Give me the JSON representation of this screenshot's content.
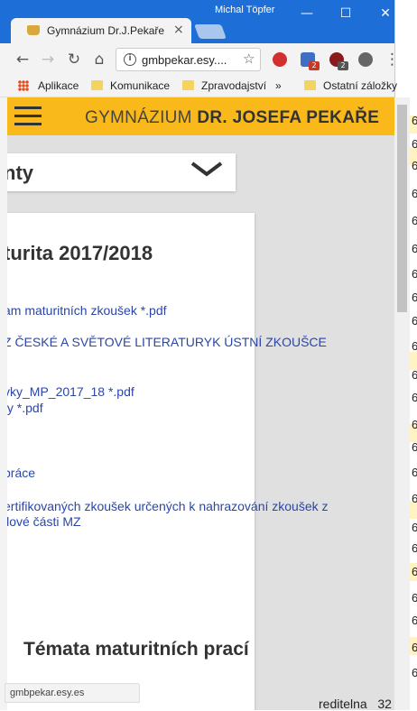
{
  "window": {
    "user": "Michal Töpfer"
  },
  "tab": {
    "title": "Gymnázium Dr.J.Pekaře",
    "close": "×"
  },
  "toolbar": {
    "url": "gmbpekar.esy....",
    "info": "i",
    "star": "☆",
    "menu": "⋮"
  },
  "extensions": {
    "badge1": "2",
    "badge2": "2"
  },
  "bookmarks": [
    {
      "label": "Aplikace"
    },
    {
      "label": "Komunikace"
    },
    {
      "label": "Zpravodajství"
    },
    {
      "label": "»"
    },
    {
      "label": "Ostatní záložky"
    }
  ],
  "site": {
    "brand_light": "GYMNÁZIUM ",
    "brand_bold": "DR. JOSEFA PEKAŘE",
    "select_label": "nty",
    "heading": "turita 2017/2018",
    "links": [
      "am maturitních zkoušek *.pdf",
      "Z ČESKÉ A SVĚTOVÉ LITERATURYK ÚSTNÍ ZKOUŠCE",
      "vky_MP_2017_18 *.pdf",
      "ty *.pdf",
      "práce",
      "ertifikovaných zkoušek určených k nahrazování zkoušek z",
      "ilové části MZ"
    ],
    "section_heading": "Témata maturitních prací"
  },
  "status_url": "gmbpekar.esy.es",
  "background": {
    "peek_label": "reditelna",
    "peek_value": "32",
    "strip": [
      "6",
      "6",
      "6",
      "6",
      "6",
      "6",
      "6",
      "6",
      "6",
      "6",
      "6",
      "6",
      "6",
      "6",
      "6",
      "6",
      "6",
      "6",
      "6",
      "6",
      "6",
      "6",
      "6",
      "6",
      "6",
      "6",
      "6",
      "6",
      "6",
      "6"
    ]
  }
}
